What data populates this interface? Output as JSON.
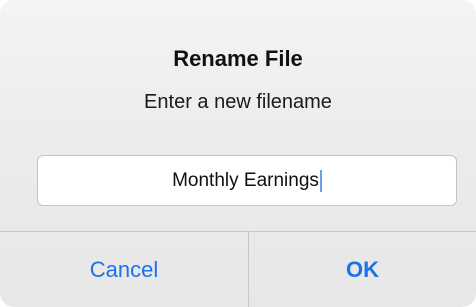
{
  "dialog": {
    "title": "Rename File",
    "message": "Enter a new filename",
    "field": {
      "value": "Monthly Earnings"
    },
    "buttons": {
      "cancel_label": "Cancel",
      "ok_label": "OK"
    }
  },
  "colors": {
    "accent": "#1a73e8",
    "caret": "#6a9cf0"
  }
}
